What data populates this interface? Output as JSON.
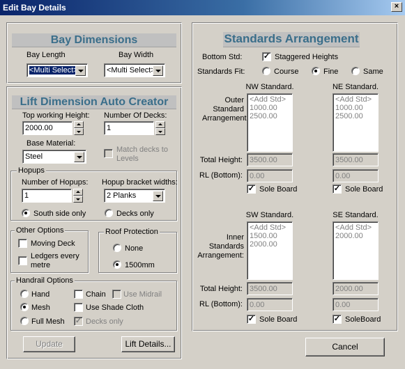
{
  "window": {
    "title": "Edit Bay Details",
    "close_glyph": "×"
  },
  "bay_dimensions": {
    "heading": "Bay Dimensions",
    "length_label": "Bay Length",
    "length_value": "<Multi Select>",
    "width_label": "Bay Width",
    "width_value": "<Multi Select>"
  },
  "lift": {
    "heading": "Lift Dimension Auto Creator",
    "top_height_label": "Top working Height:",
    "top_height_value": "2000.00",
    "num_decks_label": "Number Of Decks:",
    "num_decks_value": "1",
    "base_material_label": "Base Material:",
    "base_material_value": "Steel",
    "match_decks_label": "Match decks to Levels",
    "hopups": {
      "label": "Hopups",
      "num_label": "Number of Hopups:",
      "num_value": "1",
      "bracket_label": "Hopup bracket widths:",
      "bracket_value": "2 Planks",
      "south_label": "South side only",
      "decks_label": "Decks only"
    },
    "other_options": {
      "label": "Other Options",
      "moving_deck": "Moving Deck",
      "ledgers": "Ledgers every metre"
    },
    "roof": {
      "label": "Roof Protection",
      "none": "None",
      "mm1500": "1500mm"
    },
    "handrail": {
      "label": "Handrail Options",
      "hand": "Hand",
      "mesh": "Mesh",
      "full_mesh": "Full Mesh",
      "chain": "Chain",
      "use_midrail": "Use Midrail",
      "shade_cloth": "Use Shade Cloth",
      "decks_only": "Decks only"
    },
    "update_button": "Update",
    "lift_details_button": "Lift Details..."
  },
  "standards": {
    "heading": "Standards Arrangement",
    "bottom_std_label": "Bottom Std:",
    "staggered_label": "Staggered Heights",
    "standards_fit_label": "Standards Fit:",
    "fit_course": "Course",
    "fit_fine": "Fine",
    "fit_same": "Same",
    "outer_label": "Outer Standard Arrangement:",
    "inner_label": "Inner Standards Arrangement:",
    "total_height_label": "Total Height:",
    "rl_bottom_label": "RL (Bottom):",
    "nw": {
      "title": "NW Standard.",
      "items": [
        "<Add Std>",
        "1000.00",
        "2500.00"
      ],
      "total": "3500.00",
      "rl": "0.00",
      "sole": "Sole Board"
    },
    "ne": {
      "title": "NE Standard.",
      "items": [
        "<Add Std>",
        "1000.00",
        "2500.00"
      ],
      "total": "3500.00",
      "rl": "0.00",
      "sole": "Sole Board"
    },
    "sw": {
      "title": "SW Standard.",
      "items": [
        "<Add Std>",
        "1500.00",
        "2000.00"
      ],
      "total": "3500.00",
      "rl": "0.00",
      "sole": "Sole Board"
    },
    "se": {
      "title": "SE Standard.",
      "items": [
        "<Add Std>",
        "2000.00"
      ],
      "total": "2000.00",
      "rl": "0.00",
      "sole": "SoleBoard"
    }
  },
  "cancel_button": "Cancel",
  "check_glyph": "✓"
}
